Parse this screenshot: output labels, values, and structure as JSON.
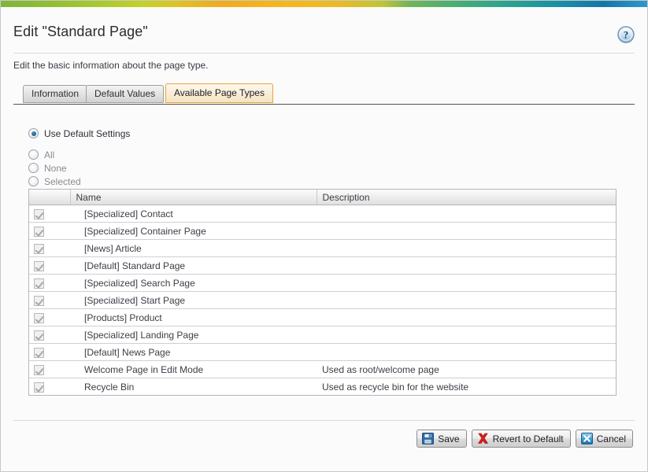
{
  "window": {
    "title": "Edit \"Standard Page\"",
    "description": "Edit the basic information about the page type.",
    "help_icon": "help-circle-icon",
    "accent_color": "#e8a33d"
  },
  "tabs": [
    {
      "label": "Information",
      "active": false
    },
    {
      "label": "Default Values",
      "active": false
    },
    {
      "label": "Available Page Types",
      "active": true
    }
  ],
  "options": {
    "mode_radios": [
      {
        "label": "Use Default Settings",
        "checked": true,
        "disabled": false
      },
      {
        "label": "All",
        "checked": false,
        "disabled": true
      },
      {
        "label": "None",
        "checked": false,
        "disabled": true
      },
      {
        "label": "Selected",
        "checked": false,
        "disabled": true
      }
    ]
  },
  "table": {
    "columns": [
      "",
      "Name",
      "Description"
    ],
    "rows": [
      {
        "checked": true,
        "name": "[Specialized] Contact",
        "description": ""
      },
      {
        "checked": true,
        "name": "[Specialized] Container Page",
        "description": ""
      },
      {
        "checked": true,
        "name": "[News] Article",
        "description": ""
      },
      {
        "checked": true,
        "name": "[Default] Standard Page",
        "description": ""
      },
      {
        "checked": true,
        "name": "[Specialized] Search Page",
        "description": ""
      },
      {
        "checked": true,
        "name": "[Specialized] Start Page",
        "description": ""
      },
      {
        "checked": true,
        "name": "[Products] Product",
        "description": ""
      },
      {
        "checked": true,
        "name": "[Specialized] Landing Page",
        "description": ""
      },
      {
        "checked": true,
        "name": "[Default] News Page",
        "description": ""
      },
      {
        "checked": true,
        "name": "Welcome Page in Edit Mode",
        "description": "Used as root/welcome page"
      },
      {
        "checked": true,
        "name": "Recycle Bin",
        "description": "Used as recycle bin for the website"
      }
    ]
  },
  "footer": {
    "buttons": [
      {
        "label": "Save",
        "icon": "floppy-disk-icon"
      },
      {
        "label": "Revert to Default",
        "icon": "red-x-icon"
      },
      {
        "label": "Cancel",
        "icon": "blue-x-icon"
      }
    ]
  }
}
